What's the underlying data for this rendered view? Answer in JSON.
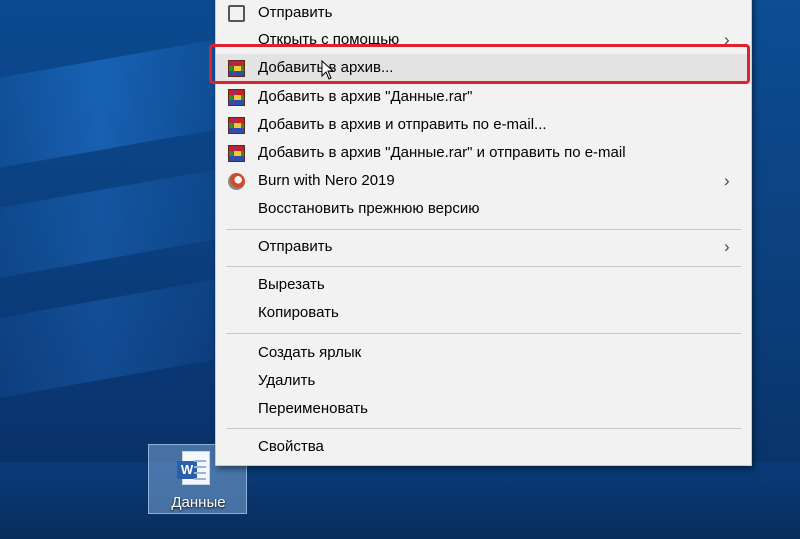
{
  "menu": {
    "items": [
      {
        "label": "Отправить",
        "icon": "share-icon",
        "submenu": false
      },
      {
        "label": "Открыть с помощью",
        "icon": "",
        "submenu": true
      },
      {
        "label": "Добавить в архив...",
        "icon": "winrar-icon",
        "submenu": false,
        "highlighted": true
      },
      {
        "label": "Добавить в архив \"Данные.rar\"",
        "icon": "winrar-icon",
        "submenu": false
      },
      {
        "label": "Добавить в архив и отправить по e-mail...",
        "icon": "winrar-icon",
        "submenu": false
      },
      {
        "label": "Добавить в архив \"Данные.rar\" и отправить по e-mail",
        "icon": "winrar-icon",
        "submenu": false
      },
      {
        "label": "Burn with Nero 2019",
        "icon": "nero-icon",
        "submenu": true
      },
      {
        "label": "Восстановить прежнюю версию",
        "icon": "",
        "submenu": false
      },
      {
        "label": "Отправить",
        "icon": "",
        "submenu": true
      },
      {
        "label": "Вырезать",
        "icon": "",
        "submenu": false
      },
      {
        "label": "Копировать",
        "icon": "",
        "submenu": false
      },
      {
        "label": "Создать ярлык",
        "icon": "",
        "submenu": false
      },
      {
        "label": "Удалить",
        "icon": "",
        "submenu": false
      },
      {
        "label": "Переименовать",
        "icon": "",
        "submenu": false
      },
      {
        "label": "Свойства",
        "icon": "",
        "submenu": false
      }
    ],
    "submenu_arrow": "›"
  },
  "desktop": {
    "file_icon_label": "Данные",
    "file_icon_letter": "W"
  },
  "colors": {
    "highlight_border": "#e0222f",
    "menu_bg": "#f2f2f2",
    "desktop_bg": "#0b4a8f"
  }
}
